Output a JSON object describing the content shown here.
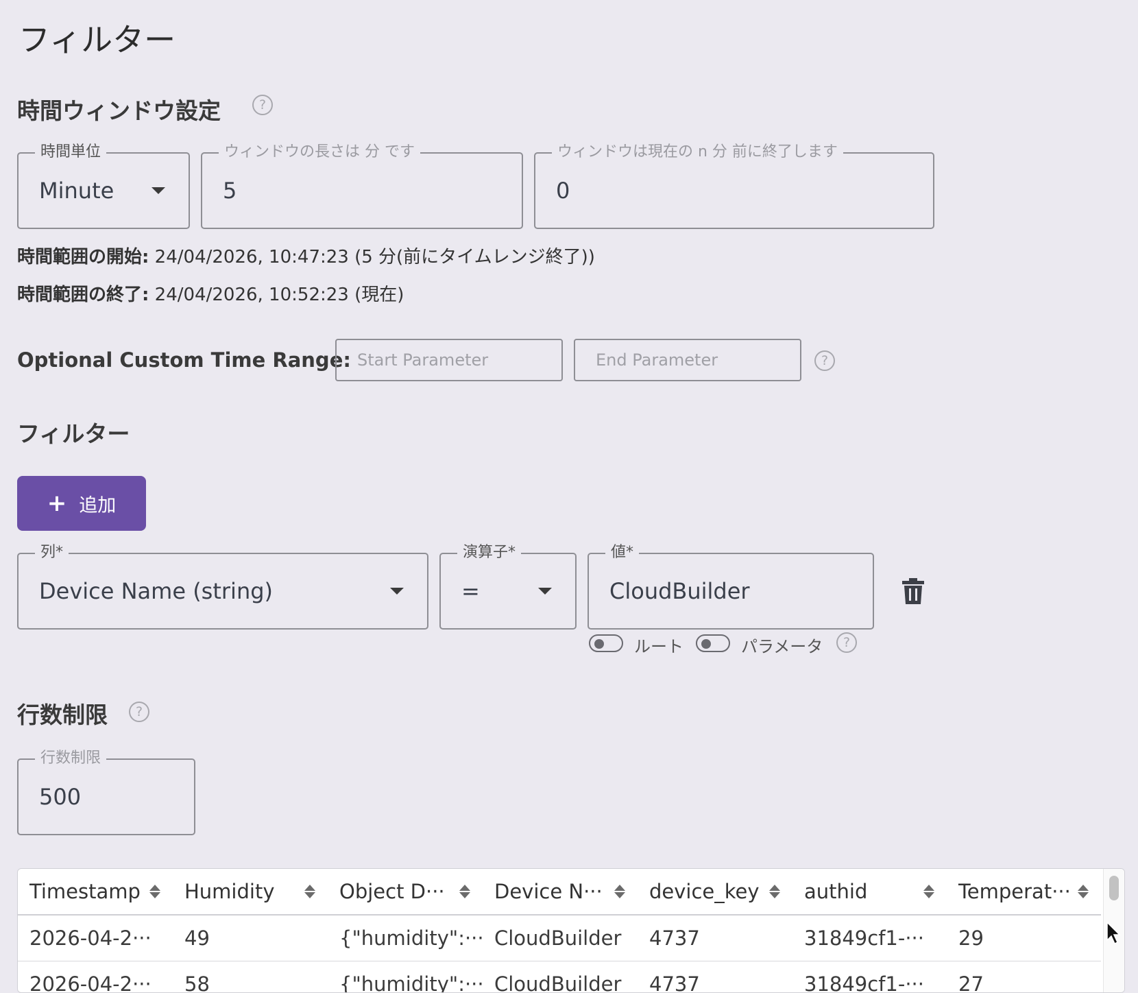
{
  "page": {
    "title": "フィルター"
  },
  "time_window": {
    "heading": "時間ウィンドウ設定",
    "help": "?",
    "unit": {
      "label": "時間単位",
      "value": "Minute"
    },
    "length": {
      "label": "ウィンドウの長さは 分 です",
      "value": "5"
    },
    "offset": {
      "label": "ウィンドウは現在の n 分 前に終了します",
      "value": "0"
    },
    "range_start": {
      "label": "時間範囲の開始:",
      "value": "24/04/2026, 10:47:23 (5 分(前にタイムレンジ終了))"
    },
    "range_end": {
      "label": "時間範囲の終了:",
      "value": "24/04/2026, 10:52:23 (現在)"
    }
  },
  "custom_range": {
    "label": "Optional Custom Time Range:",
    "start_placeholder": "Start Parameter",
    "end_placeholder": "End Parameter",
    "help": "?"
  },
  "filters": {
    "heading": "フィルター",
    "add_label": "追加",
    "add_icon": "+",
    "rows": [
      {
        "column": {
          "label": "列*",
          "value": "Device Name (string)"
        },
        "operator": {
          "label": "演算子*",
          "value": "="
        },
        "value": {
          "label": "値*",
          "value": "CloudBuilder"
        },
        "toggle_route": "ルート",
        "toggle_param": "パラメータ",
        "help": "?"
      }
    ]
  },
  "row_limit": {
    "heading": "行数制限",
    "help": "?",
    "field_label": "行数制限",
    "value": "500"
  },
  "table": {
    "columns": [
      "Timestamp",
      "Humidity",
      "Object D···",
      "Device N···",
      "device_key",
      "authid",
      "Temperat···"
    ],
    "rows": [
      [
        "2026-04-2···",
        "49",
        "{\"humidity\":···",
        "CloudBuilder",
        "4737",
        "31849cf1-···",
        "29"
      ],
      [
        "2026-04-2···",
        "58",
        "{\"humidity\":···",
        "CloudBuilder",
        "4737",
        "31849cf1-···",
        "27"
      ]
    ]
  },
  "colors": {
    "accent": "#6a4fa6",
    "background": "#ebe9f0"
  }
}
